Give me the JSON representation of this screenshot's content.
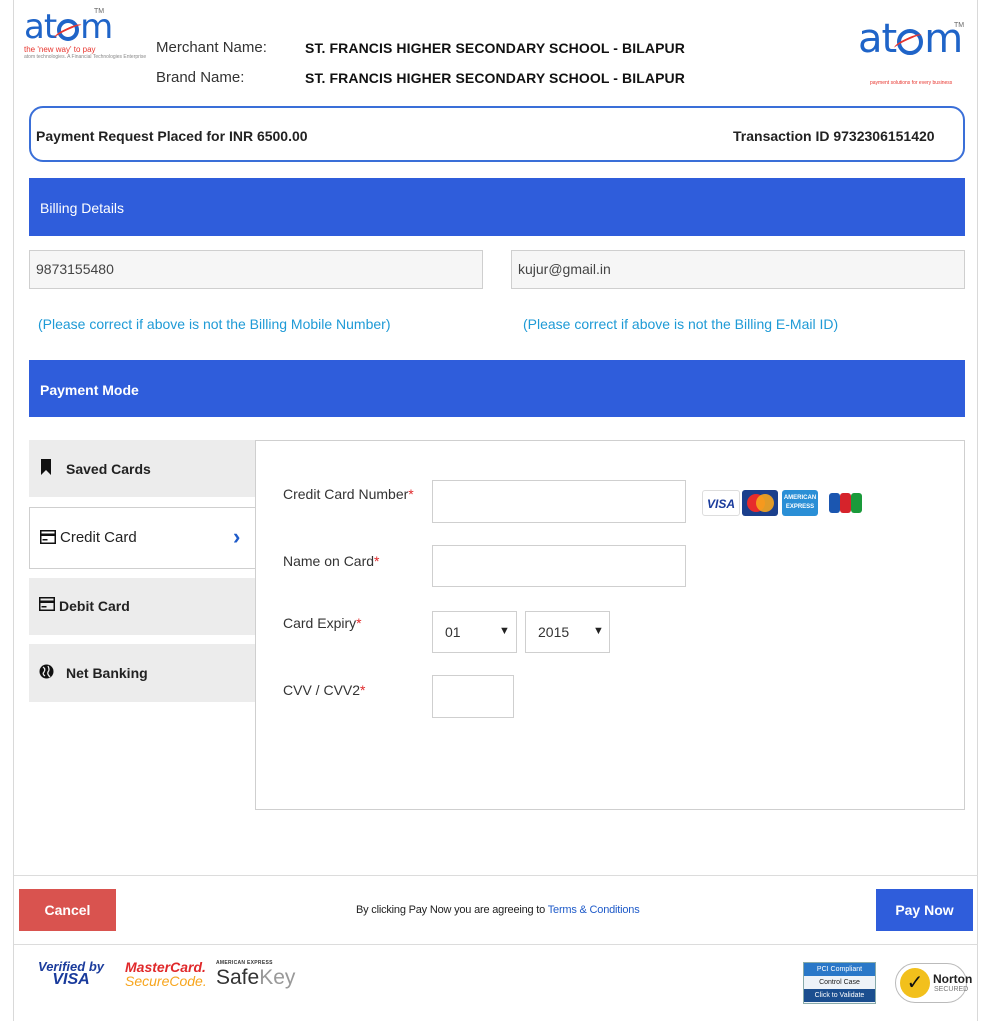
{
  "header": {
    "logo_left": {
      "word": "atom",
      "tm": "TM",
      "tagline": "the 'new way' to pay",
      "subtag": "atom technologies. A Financial Technologies Enterprise"
    },
    "logo_right": {
      "word": "atom",
      "tm": "TM",
      "subtag": "payment solutions for every business"
    },
    "merchant_label": "Merchant Name:",
    "brand_label": "Brand Name:",
    "merchant_name": "ST. FRANCIS HIGHER SECONDARY SCHOOL - BILAPUR",
    "brand_name": "ST. FRANCIS HIGHER SECONDARY SCHOOL - BILAPUR"
  },
  "request": {
    "placed_text": "Payment Request Placed for INR 6500.00",
    "transaction_text": "Transaction ID 9732306151420"
  },
  "billing": {
    "title": "Billing Details",
    "mobile_value": "9873155480",
    "email_value": "kujur@gmail.in",
    "mobile_hint": "(Please correct if above is not the Billing Mobile Number)",
    "email_hint": "(Please correct if above is not the Billing E-Mail ID)"
  },
  "payment": {
    "title": "Payment Mode",
    "tabs": [
      {
        "label": "Saved Cards",
        "icon": "bookmark-icon"
      },
      {
        "label": "Credit Card",
        "icon": "credit-card-icon",
        "active": true
      },
      {
        "label": "Debit Card",
        "icon": "debit-card-icon"
      },
      {
        "label": "Net Banking",
        "icon": "globe-icon"
      }
    ],
    "active_chevron": "›",
    "form": {
      "card_number_label": "Credit Card Number",
      "name_label": "Name on Card",
      "expiry_label": "Card Expiry",
      "cvv_label": "CVV / CVV2",
      "required_mark": "*",
      "expiry_month": "01",
      "expiry_year": "2015"
    },
    "card_brands": {
      "visa": "VISA",
      "amex": "AMERICAN EXPRESS",
      "others": [
        "mastercard-logo",
        "jcb-logo"
      ]
    }
  },
  "footer": {
    "cancel_label": "Cancel",
    "pay_label": "Pay Now",
    "agree_prefix": "By clicking Pay Now you are agreeing to",
    "terms_link": "Terms & Conditions"
  },
  "trust_badges": {
    "vbv_line1": "Verified by",
    "vbv_line2": "VISA",
    "mc_line1": "MasterCard.",
    "mc_line2": "SecureCode.",
    "amex_top": "AMERICAN EXPRESS",
    "amex_safe": "Safe",
    "amex_key": "Key",
    "pci_line1": "PCI Compliant",
    "pci_line2": "Control Case",
    "pci_line3": "Click to Validate",
    "norton_name": "Norton",
    "norton_sub": "SECURED"
  },
  "colors": {
    "brand_blue": "#2f5ddb",
    "cancel_red": "#d9534f",
    "hint_blue": "#1e9ad6",
    "required_red": "#e0292b"
  }
}
